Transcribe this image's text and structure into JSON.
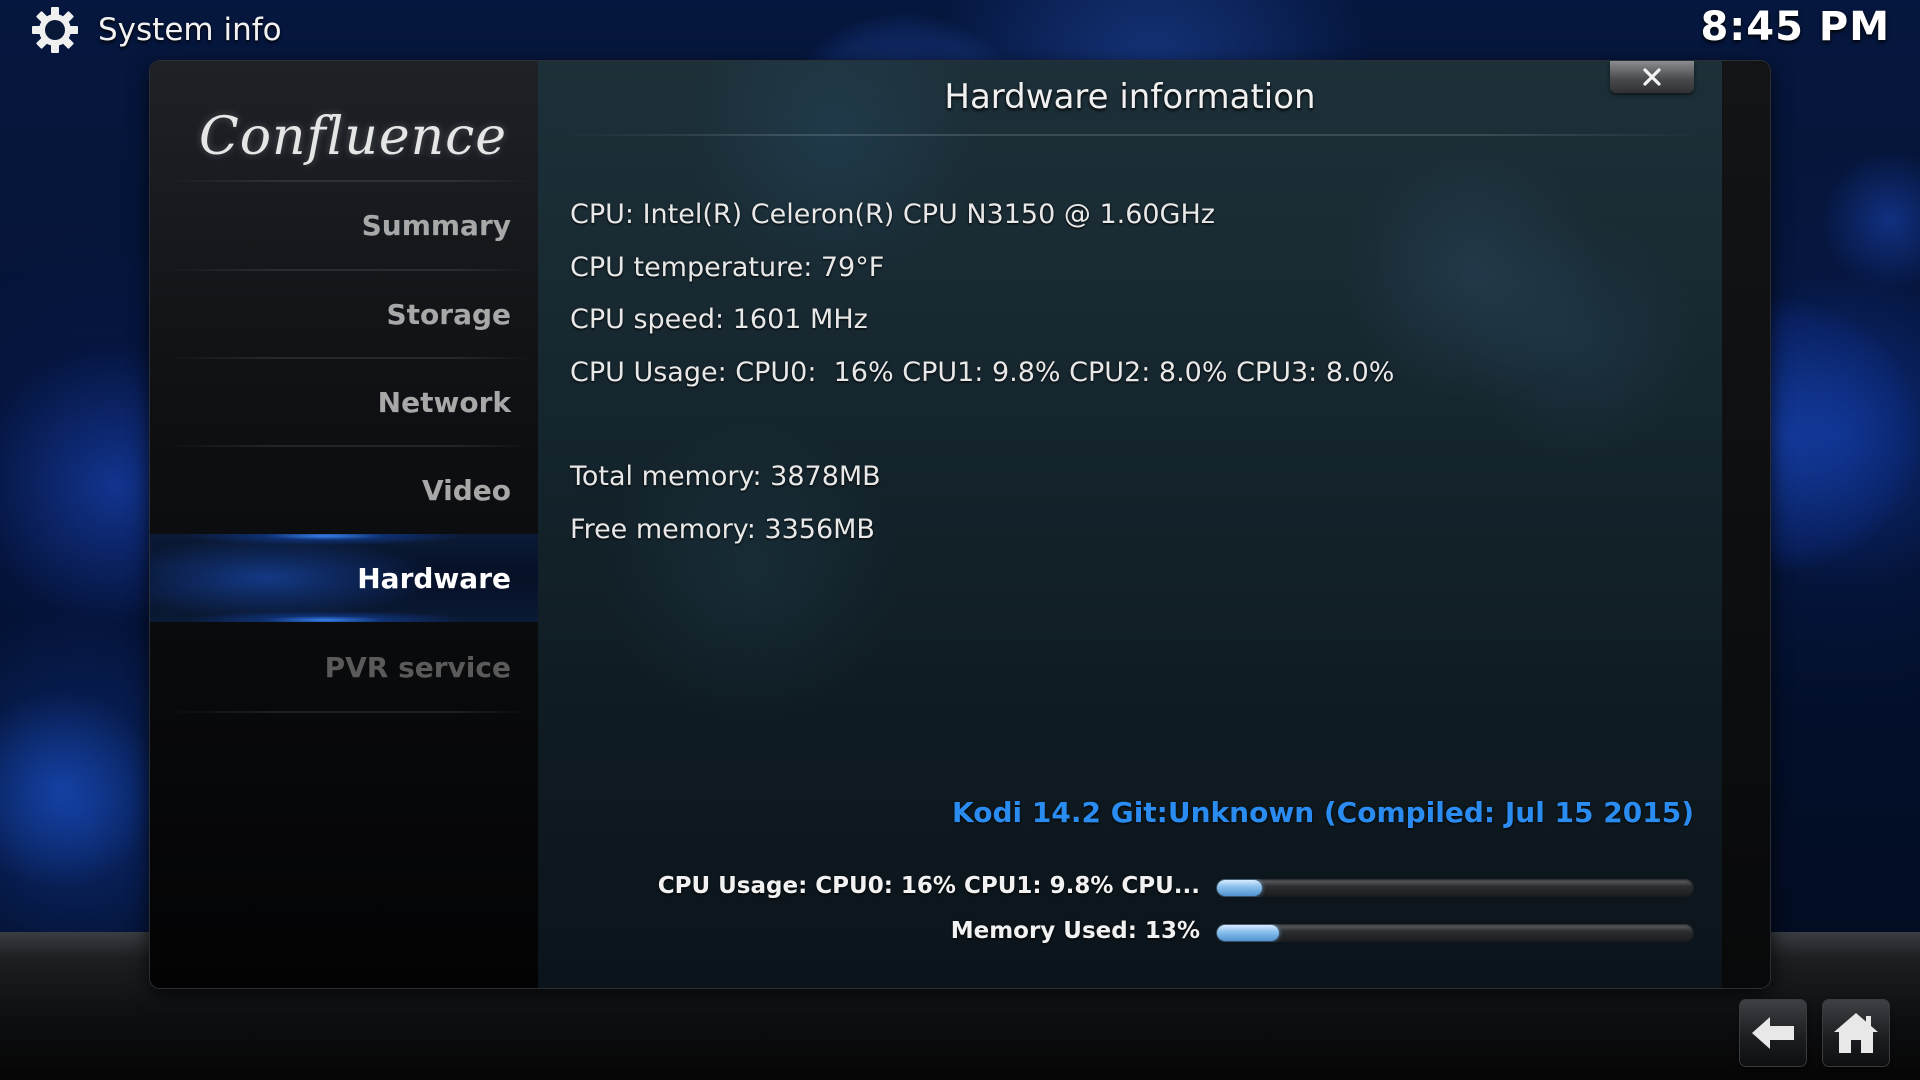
{
  "header": {
    "title": "System info",
    "icon": "gear-icon",
    "clock": "8:45 PM"
  },
  "dialog": {
    "title": "Hardware information",
    "close_icon": "close-icon"
  },
  "sidebar": {
    "logo": "Confluence",
    "items": [
      {
        "label": "Summary",
        "state": "normal"
      },
      {
        "label": "Storage",
        "state": "normal"
      },
      {
        "label": "Network",
        "state": "normal"
      },
      {
        "label": "Video",
        "state": "normal"
      },
      {
        "label": "Hardware",
        "state": "selected"
      },
      {
        "label": "PVR service",
        "state": "disabled"
      }
    ]
  },
  "hardware": {
    "cpu": "CPU: Intel(R) Celeron(R) CPU N3150 @ 1.60GHz",
    "cpu_temperature": "CPU temperature: 79°F",
    "cpu_speed": "CPU speed: 1601 MHz",
    "cpu_usage": "CPU Usage: CPU0:  16% CPU1: 9.8% CPU2: 8.0% CPU3: 8.0%",
    "total_memory": "Total memory: 3878MB",
    "free_memory": "Free memory: 3356MB"
  },
  "build_info": "Kodi 14.2 Git:Unknown (Compiled: Jul 15 2015)",
  "usage_bars": {
    "cpu": {
      "label": "CPU Usage: CPU0:  16% CPU1: 9.8% CPU...",
      "percent": 9.5
    },
    "memory": {
      "label": "Memory Used: 13%",
      "percent": 13
    }
  },
  "bottom_buttons": {
    "back_icon": "back-arrow-icon",
    "home_icon": "home-icon"
  },
  "colors": {
    "accent_blue": "#2a8cf0",
    "selected_glow": "#3c8cff"
  }
}
